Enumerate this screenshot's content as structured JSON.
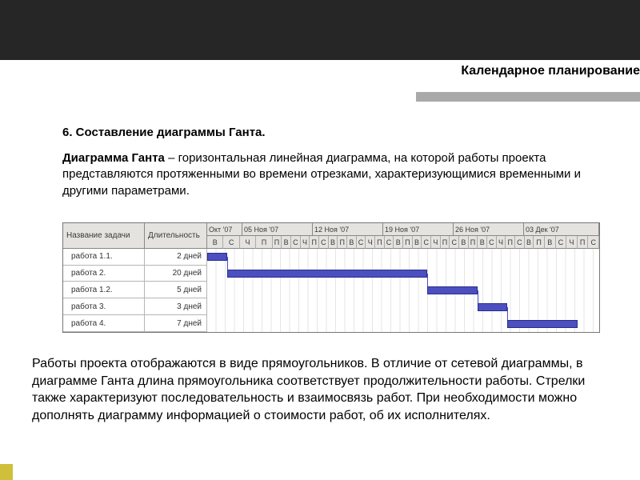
{
  "title": "Календарное планирование",
  "heading": "6. Составление диаграммы Ганта.",
  "definition_bold": "Диаграмма Ганта",
  "definition_rest": " – горизонтальная линейная диаграмма, на которой работы проекта представляются протяженными во времени отрезками, характеризующимися временными и другими параметрами.",
  "footer_text": "Работы проекта отображаются в виде прямоугольников. В отличие от сетевой диаграммы, в диаграмме Ганта длина прямоугольника соответствует продолжительности работы. Стрелки также характеризуют последовательность и взаимосвязь работ. При необходимости можно дополнять диаграмму информацией о стоимости работ, об их исполнителях.",
  "table_headers": {
    "name": "Название задачи",
    "duration": "Длительность"
  },
  "tasks": [
    {
      "name": "работа 1.1.",
      "duration": "2 дней"
    },
    {
      "name": "работа 2.",
      "duration": "20 дней"
    },
    {
      "name": "работа 1.2.",
      "duration": "5 дней"
    },
    {
      "name": "работа 3.",
      "duration": "3 дней"
    },
    {
      "name": "работа 4.",
      "duration": "7 дней"
    }
  ],
  "weeks": [
    {
      "label": "Окт '07",
      "days": "В С Ч П"
    },
    {
      "label": "05 Ноя '07",
      "days": "П В С Ч П С В"
    },
    {
      "label": "12 Ноя '07",
      "days": "П В С Ч П С В"
    },
    {
      "label": "19 Ноя '07",
      "days": "П В С Ч П С В"
    },
    {
      "label": "26 Ноя '07",
      "days": "П В С Ч П С В"
    },
    {
      "label": "03 Дек '07",
      "days": "П В С Ч П С"
    }
  ],
  "chart_data": {
    "type": "gantt",
    "unit": "days",
    "rows": [
      {
        "task": "работа 1.1.",
        "start": 0,
        "duration": 2
      },
      {
        "task": "работа 2.",
        "start": 2,
        "duration": 20
      },
      {
        "task": "работа 1.2.",
        "start": 22,
        "duration": 5
      },
      {
        "task": "работа 3.",
        "start": 27,
        "duration": 3
      },
      {
        "task": "работа 4.",
        "start": 30,
        "duration": 7
      }
    ],
    "dependencies": [
      [
        "работа 1.1.",
        "работа 2."
      ],
      [
        "работа 2.",
        "работа 1.2."
      ],
      [
        "работа 1.2.",
        "работа 3."
      ],
      [
        "работа 3.",
        "работа 4."
      ]
    ],
    "timeline_start": "Окт '07",
    "timeline_weeks": [
      "Окт '07",
      "05 Ноя '07",
      "12 Ноя '07",
      "19 Ноя '07",
      "26 Ноя '07",
      "03 Дек '07"
    ]
  }
}
